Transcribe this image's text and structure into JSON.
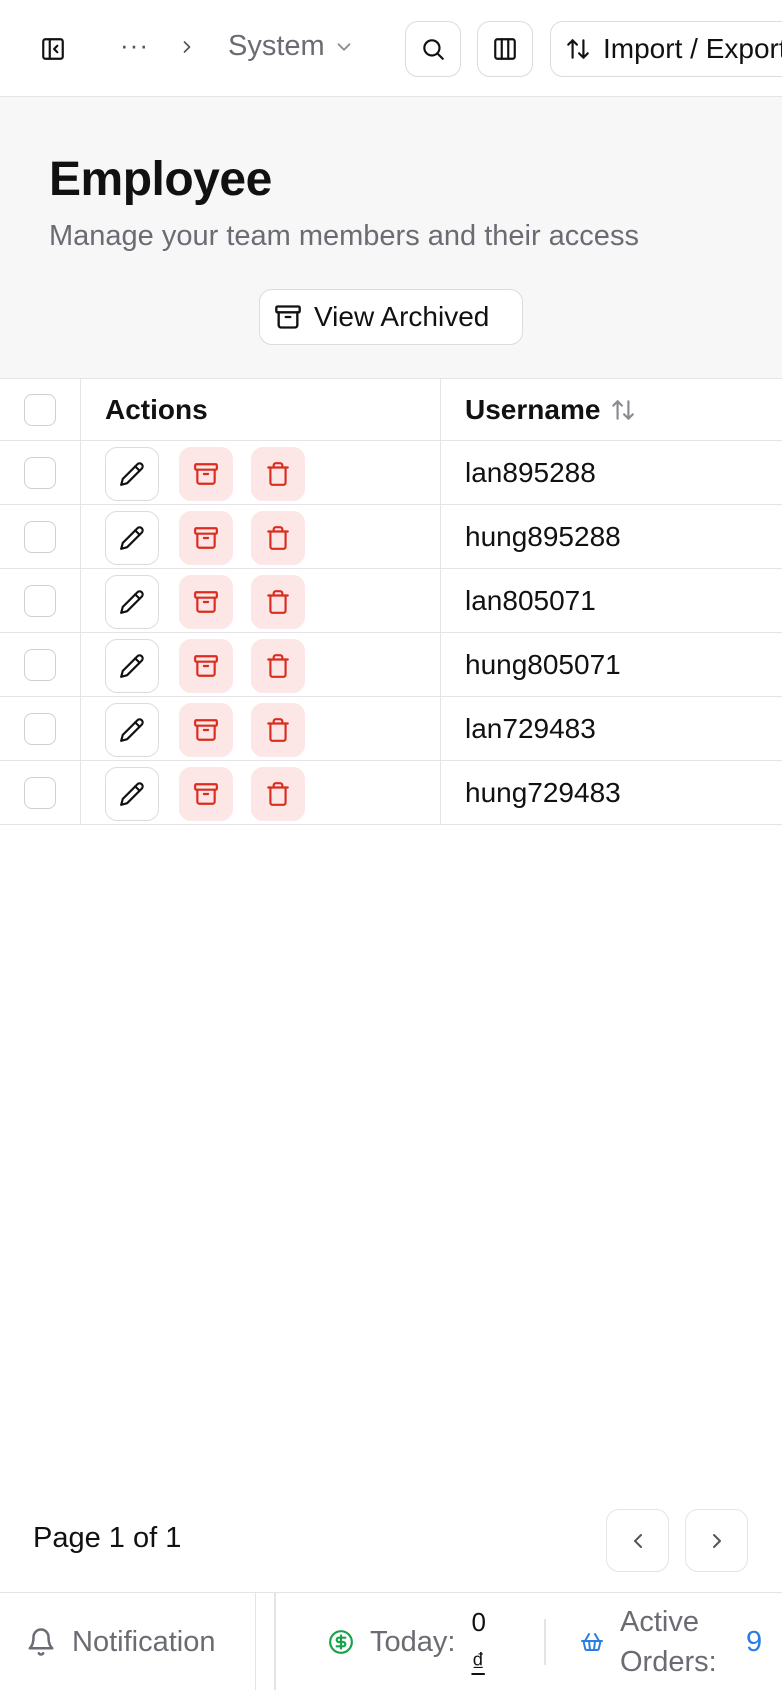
{
  "topbar": {
    "breadcrumb_more": "···",
    "breadcrumb_current": "System",
    "import_export_label": "Import / Export"
  },
  "header": {
    "title": "Employee",
    "subtitle": "Manage your team members and their access",
    "view_archived_label": "View Archived"
  },
  "table": {
    "columns": {
      "actions": "Actions",
      "username": "Username"
    },
    "rows": [
      {
        "username": "lan895288"
      },
      {
        "username": "hung895288"
      },
      {
        "username": "lan805071"
      },
      {
        "username": "hung805071"
      },
      {
        "username": "lan729483"
      },
      {
        "username": "hung729483"
      }
    ]
  },
  "pagination": {
    "label": "Page 1 of 1"
  },
  "footer": {
    "notification_label": "Notification",
    "today_label": "Today:",
    "today_value": "0",
    "today_currency": "₫",
    "active_orders_label": "Active Orders:",
    "active_orders_value": "9"
  },
  "colors": {
    "danger": "#d92d20",
    "danger_bg": "#fde6e6",
    "accent_blue": "#2a7de1",
    "money_green": "#16a34a",
    "muted_text": "#6b6b73",
    "border": "#e4e4e7"
  }
}
